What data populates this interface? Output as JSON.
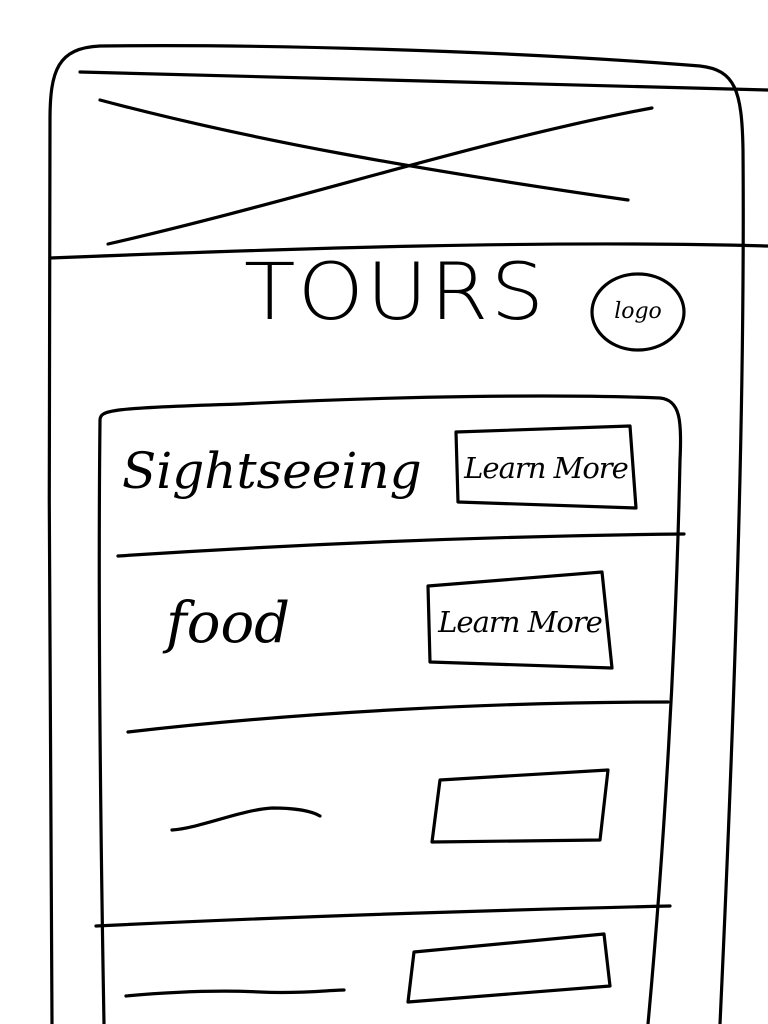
{
  "hero": {
    "image_placeholder": "image-placeholder-x"
  },
  "header": {
    "title": "TOURS",
    "logo_text": "logo"
  },
  "tours": [
    {
      "label": "Sightseeing",
      "button_label": "Learn More"
    },
    {
      "label": "food",
      "button_label": "Learn More"
    },
    {
      "label": "",
      "button_label": ""
    },
    {
      "label": "",
      "button_label": ""
    }
  ],
  "colors": {
    "ink": "#000000",
    "paper": "#ffffff"
  }
}
